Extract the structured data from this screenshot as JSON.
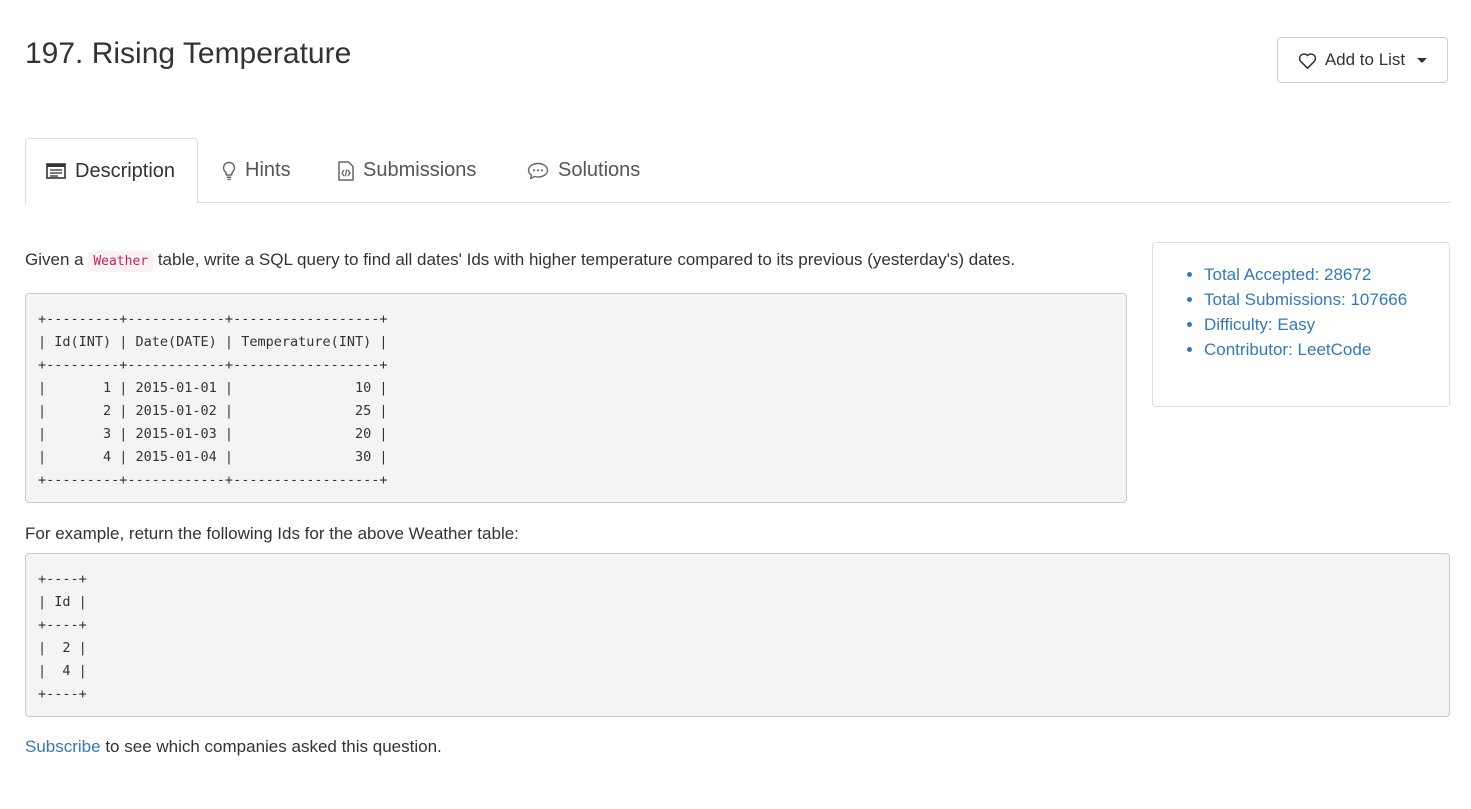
{
  "header": {
    "title": "197. Rising Temperature",
    "add_to_list_label": "Add to List"
  },
  "tabs": [
    {
      "label": "Description",
      "icon": "description-icon",
      "active": true
    },
    {
      "label": "Hints",
      "icon": "lightbulb-icon",
      "active": false
    },
    {
      "label": "Submissions",
      "icon": "code-file-icon",
      "active": false
    },
    {
      "label": "Solutions",
      "icon": "chat-bubble-icon",
      "active": false
    }
  ],
  "description": {
    "prefix": "Given a ",
    "inline_code": "Weather",
    "suffix": " table, write a SQL query to find all dates' Ids with higher temperature compared to its previous (yesterday's) dates.",
    "weather_table": "+---------+------------+------------------+\n| Id(INT) | Date(DATE) | Temperature(INT) |\n+---------+------------+------------------+\n|       1 | 2015-01-01 |               10 |\n|       2 | 2015-01-02 |               25 |\n|       3 | 2015-01-03 |               20 |\n|       4 | 2015-01-04 |               30 |\n+---------+------------+------------------+",
    "example_text": "For example, return the following Ids for the above Weather table:",
    "result_table": "+----+\n| Id |\n+----+\n|  2 |\n|  4 |\n+----+",
    "subscribe_link": "Subscribe",
    "subscribe_suffix": " to see which companies asked this question."
  },
  "stats": {
    "total_accepted": "Total Accepted: 28672",
    "total_submissions": "Total Submissions: 107666",
    "difficulty": "Difficulty: Easy",
    "contributor": "Contributor: LeetCode"
  },
  "colors": {
    "link": "#337ab7",
    "inline_code_text": "#c7254e",
    "inline_code_bg": "#f9f2f4",
    "code_block_bg": "#f4f4f4"
  }
}
